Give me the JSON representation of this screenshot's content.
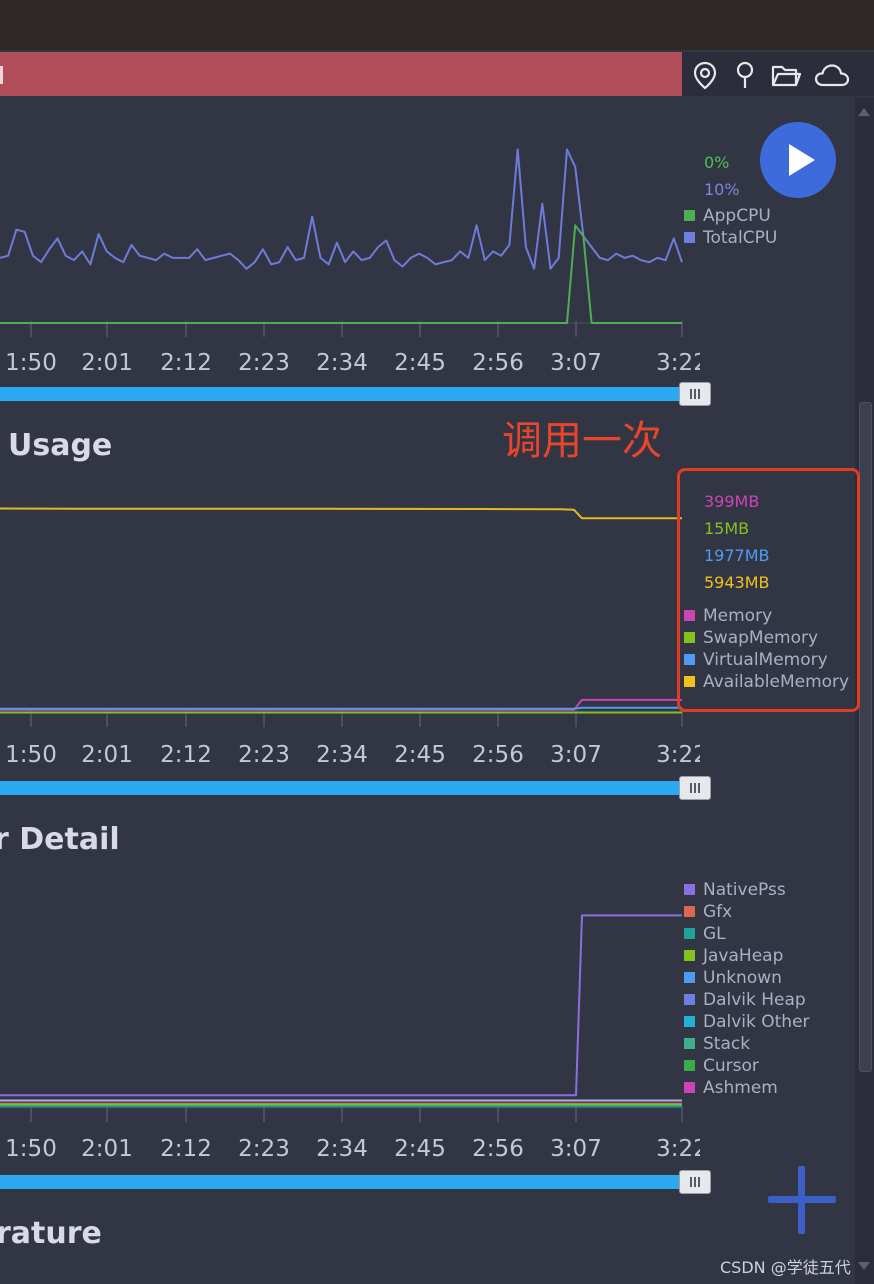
{
  "window": {
    "annotation_text": "调用一次",
    "watermark": "CSDN @学徒五代",
    "toolbar_icons": [
      "location-pin-icon",
      "map-pin-icon",
      "folder-open-icon",
      "cloud-icon"
    ]
  },
  "sections": [
    {
      "title": ""
    },
    {
      "title": "Usage"
    },
    {
      "title": "r Detail"
    },
    {
      "title": "rature"
    }
  ],
  "chart_data": [
    {
      "type": "line",
      "title": "",
      "x_ticks": [
        "1:50",
        "2:01",
        "2:12",
        "2:23",
        "2:34",
        "2:45",
        "2:56",
        "3:07",
        "3:22"
      ],
      "current_values": [
        {
          "text": "0%",
          "color": "#4bc259"
        },
        {
          "text": "10%",
          "color": "#7d86dd"
        }
      ],
      "legend": [
        {
          "label": "AppCPU",
          "color": "#4caf50"
        },
        {
          "label": "TotalCPU",
          "color": "#6f7ee0"
        }
      ],
      "ylim": [
        0,
        100
      ],
      "series": [
        {
          "name": "TotalCPU",
          "color": "#6e7bd9",
          "values": [
            30,
            31,
            43,
            42,
            31,
            28,
            34,
            39,
            31,
            29,
            33,
            27,
            41,
            33,
            30,
            28,
            36,
            31,
            30,
            29,
            32,
            30,
            30,
            30,
            34,
            29,
            30,
            31,
            32,
            29,
            25,
            28,
            34,
            27,
            28,
            35,
            29,
            30,
            49,
            30,
            27,
            37,
            28,
            33,
            29,
            30,
            35,
            38,
            29,
            26,
            30,
            32,
            30,
            27,
            28,
            29,
            33,
            30,
            45,
            29,
            33,
            31,
            36,
            80,
            35,
            25,
            55,
            25,
            30,
            80,
            72,
            40,
            35,
            30,
            29,
            32,
            30,
            31,
            29,
            28,
            30,
            29,
            39,
            28
          ],
          "x_step_seconds": 8
        },
        {
          "name": "AppCPU",
          "color": "#4caf50",
          "values": [
            0,
            0,
            0,
            0,
            0,
            0,
            0,
            0,
            0,
            0,
            0,
            0,
            0,
            0,
            0,
            0,
            0,
            0,
            0,
            0,
            0,
            0,
            0,
            0,
            0,
            0,
            0,
            0,
            0,
            0,
            0,
            0,
            0,
            0,
            0,
            0,
            0,
            0,
            0,
            0,
            0,
            0,
            0,
            0,
            0,
            0,
            0,
            0,
            0,
            0,
            0,
            0,
            0,
            0,
            0,
            0,
            0,
            0,
            0,
            0,
            0,
            0,
            0,
            0,
            0,
            0,
            0,
            0,
            0,
            0,
            45,
            40,
            0,
            0,
            0,
            0,
            0,
            0,
            0,
            0,
            0,
            0,
            0,
            0
          ]
        }
      ]
    },
    {
      "type": "line",
      "title": "Usage",
      "x_ticks": [
        "1:50",
        "2:01",
        "2:12",
        "2:23",
        "2:34",
        "2:45",
        "2:56",
        "3:07",
        "3:22"
      ],
      "current_values": [
        {
          "text": "399MB",
          "color": "#cc44b6"
        },
        {
          "text": "15MB",
          "color": "#84c21c"
        },
        {
          "text": "1977MB",
          "color": "#4d9cf2"
        },
        {
          "text": "5943MB",
          "color": "#f0c21b"
        }
      ],
      "legend": [
        {
          "label": "Memory",
          "color": "#cc44b6"
        },
        {
          "label": "SwapMemory",
          "color": "#84c21c"
        },
        {
          "label": "VirtualMemory",
          "color": "#4d9cf2"
        },
        {
          "label": "AvailableMemory",
          "color": "#f0c21b"
        }
      ],
      "ylim": [
        0,
        6500
      ],
      "series": [
        {
          "name": "AvailableMemory",
          "color": "#e3b923",
          "values": [
            6240,
            6235,
            6230,
            6232,
            6230,
            6228,
            6225,
            6220,
            6200,
            5943,
            5943
          ]
        },
        {
          "name": "Memory",
          "color": "#cc44b6",
          "values": [
            100,
            100,
            100,
            100,
            100,
            100,
            100,
            100,
            100,
            399,
            399
          ]
        },
        {
          "name": "VirtualMemory",
          "color": "#4d9cf2",
          "values": [
            130,
            130,
            130,
            130,
            130,
            130,
            130,
            130,
            130,
            160,
            160
          ]
        },
        {
          "name": "SwapMemory",
          "color": "#84c21c",
          "values": [
            15,
            15,
            15,
            15,
            15,
            15,
            15,
            15,
            15,
            15,
            15
          ]
        }
      ]
    },
    {
      "type": "line",
      "title": "r Detail",
      "x_ticks": [
        "1:50",
        "2:01",
        "2:12",
        "2:23",
        "2:34",
        "2:45",
        "2:56",
        "3:07",
        "3:22"
      ],
      "legend": [
        {
          "label": "NativePss",
          "color": "#8a6fe0"
        },
        {
          "label": "Gfx",
          "color": "#e0664f"
        },
        {
          "label": "GL",
          "color": "#1ea39a"
        },
        {
          "label": "JavaHeap",
          "color": "#84c21c"
        },
        {
          "label": "Unknown",
          "color": "#4d9cf2"
        },
        {
          "label": "Dalvik Heap",
          "color": "#6f7ee0"
        },
        {
          "label": "Dalvik Other",
          "color": "#23b0d6"
        },
        {
          "label": "Stack",
          "color": "#3fae8d"
        },
        {
          "label": "Cursor",
          "color": "#3daa4a"
        },
        {
          "label": "Ashmem",
          "color": "#cc44b6"
        }
      ],
      "ylim": [
        0,
        100
      ],
      "series": [
        {
          "name": "NativePss",
          "color": "#8a6fe0",
          "values": [
            6,
            6,
            6,
            6,
            6,
            6,
            6,
            6,
            6,
            6,
            6,
            90,
            90
          ]
        },
        {
          "name": "Dalvik Heap",
          "color": "#aaaee8",
          "values": [
            3.5,
            3.5,
            3.5,
            3.5,
            3.5,
            3.5,
            3.5,
            3.5,
            3.5,
            3.5,
            3.5,
            3.5,
            3.5
          ]
        },
        {
          "name": "Gfx",
          "color": "#e0664f",
          "values": [
            2,
            2,
            2,
            2,
            2,
            2,
            2,
            2,
            2,
            2,
            2,
            2,
            2
          ]
        },
        {
          "name": "JavaHeap",
          "color": "#84c21c",
          "values": [
            1.5,
            1.5,
            1.5,
            1.5,
            1.5,
            1.5,
            1.5,
            1.5,
            1.5,
            1.5,
            1.5,
            1.5,
            1.5
          ]
        },
        {
          "name": "GL",
          "color": "#1ea39a",
          "values": [
            0.8,
            0.8,
            0.8,
            0.8,
            0.8,
            0.8,
            0.8,
            0.8,
            0.8,
            0.8,
            0.8,
            0.8,
            0.8
          ]
        }
      ]
    }
  ]
}
